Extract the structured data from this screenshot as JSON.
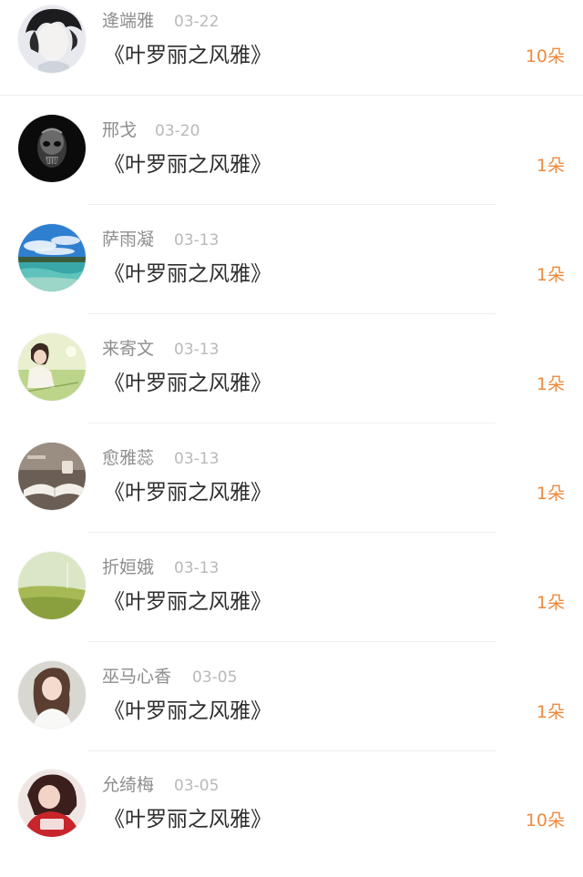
{
  "rows": [
    {
      "name": "逄端雅",
      "date": "03-22",
      "title": "《叶罗丽之风雅》",
      "amount": "10朵",
      "avatar": "dark-hair-boy-avatar"
    },
    {
      "name": "邢戈",
      "date": "03-20",
      "title": "《叶罗丽之风雅》",
      "amount": "1朵",
      "avatar": "skull-mask-avatar"
    },
    {
      "name": "萨雨凝",
      "date": "03-13",
      "title": "《叶罗丽之风雅》",
      "amount": "1朵",
      "avatar": "sea-sky-avatar"
    },
    {
      "name": "来寄文",
      "date": "03-13",
      "title": "《叶罗丽之风雅》",
      "amount": "1朵",
      "avatar": "girl-in-field-avatar"
    },
    {
      "name": "愈雅蕊",
      "date": "03-13",
      "title": "《叶罗丽之风雅》",
      "amount": "1朵",
      "avatar": "book-coffee-avatar"
    },
    {
      "name": "折姮娥",
      "date": "03-13",
      "title": "《叶罗丽之风雅》",
      "amount": "1朵",
      "avatar": "grassland-avatar"
    },
    {
      "name": "巫马心香",
      "date": "03-05",
      "title": "《叶罗丽之风雅》",
      "amount": "1朵",
      "avatar": "woman-portrait-avatar"
    },
    {
      "name": "允绮梅",
      "date": "03-05",
      "title": "《叶罗丽之风雅》",
      "amount": "10朵",
      "avatar": "red-hood-girl-avatar"
    }
  ],
  "colors": {
    "name": "#8e8e8e",
    "date": "#b9b9b9",
    "title": "#2e2e2e",
    "amount": "#ed8a3f"
  }
}
